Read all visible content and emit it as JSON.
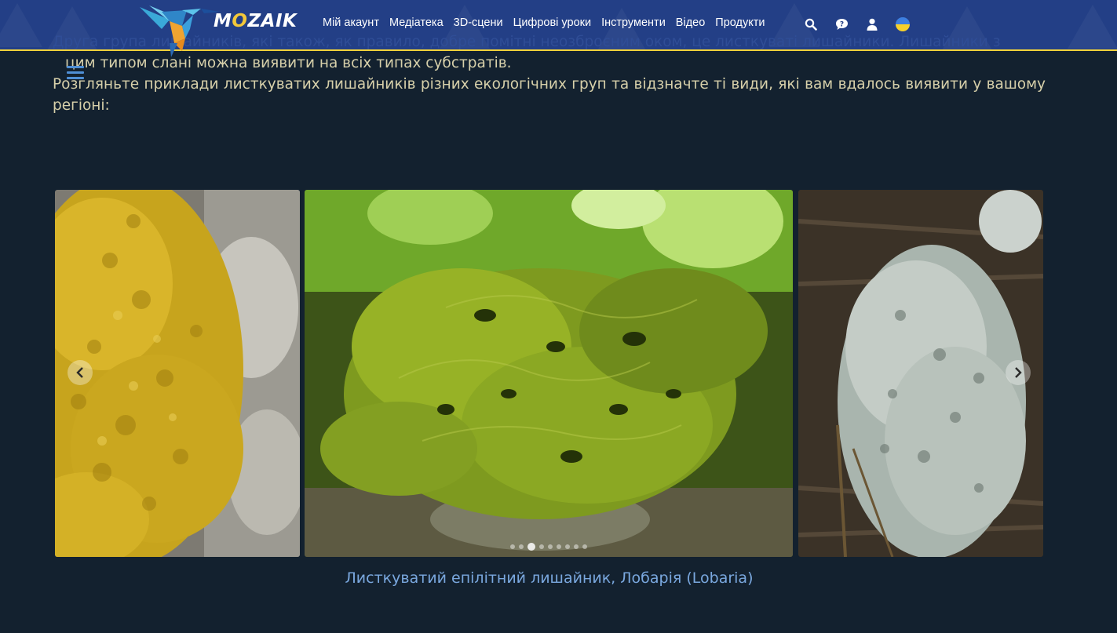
{
  "header": {
    "logo_text": "MOZAIK",
    "nav": [
      {
        "label": "Мій акаунт"
      },
      {
        "label": "Медіатека"
      },
      {
        "label": "3D-сцени"
      },
      {
        "label": "Цифрові уроки"
      },
      {
        "label": "Інструменти"
      },
      {
        "label": "Відео"
      },
      {
        "label": "Продукти"
      }
    ],
    "icons": [
      "search-icon",
      "help-chat-icon",
      "user-icon",
      "language-flag-ukraine-icon"
    ],
    "colors": {
      "bar": "#233f86",
      "accent_line": "#f1d23a"
    }
  },
  "article": {
    "faded_line": "Друга група лишайників, які також, як правило, добре помітні неозброєним оком, це листкуваті лишайники. Лишайники з",
    "line_1": "цим типом слані можна виявити на всіх типах субстратів.",
    "paragraph_2": "Розгляньте приклади листкуватих лишайників різних екологічних груп та відзначте ті види, які вам вдалось виявити у вашому регіоні:"
  },
  "gallery": {
    "slides": [
      {
        "name": "yellow-crustose-lichen-photo"
      },
      {
        "name": "lobaria-lichen-photo"
      },
      {
        "name": "grey-foliose-lichen-photo"
      }
    ],
    "dot_count": 9,
    "active_dot": 2,
    "caption": "Листкуватий епілітний лишайник, Лобарія (Lobaria)"
  }
}
